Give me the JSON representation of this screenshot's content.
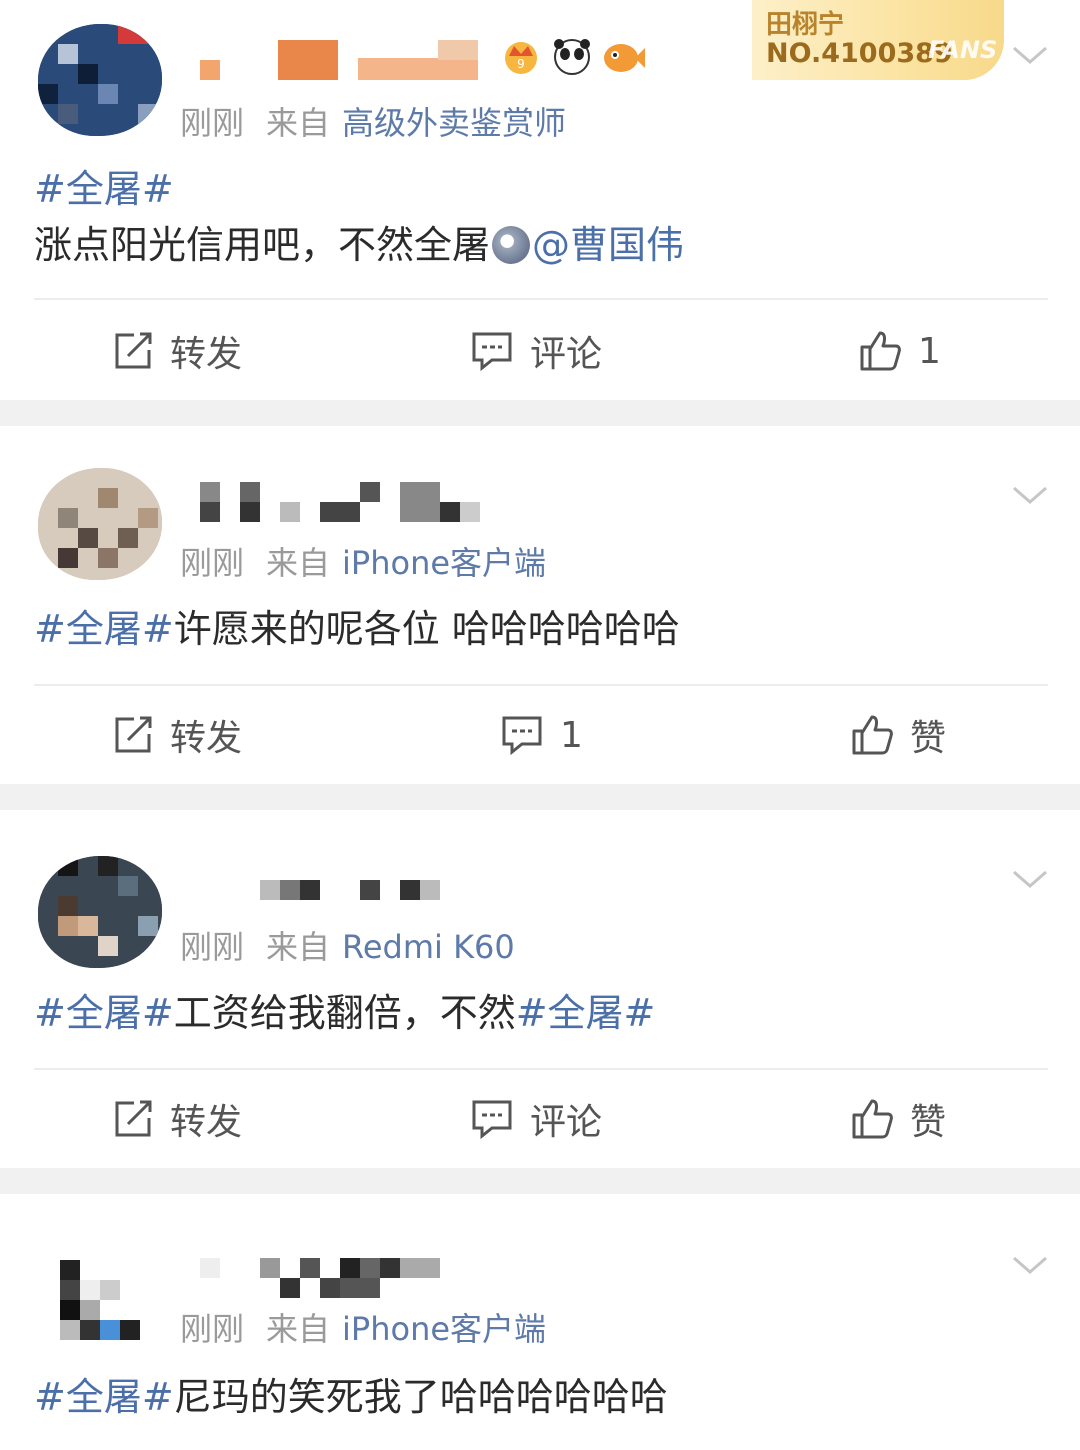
{
  "posts": [
    {
      "meta_time": "刚刚",
      "meta_from": "来自",
      "meta_source": "高级外卖鉴赏师",
      "content_tag": "#全屠#",
      "content_text": "涨点阳光信用吧，不然全屠",
      "content_mention": "@曹国伟",
      "action_repost": "转发",
      "action_comment": "评论",
      "action_like": "1"
    },
    {
      "meta_time": "刚刚",
      "meta_from": "来自",
      "meta_source": "iPhone客户端",
      "content_tag": "#全屠#",
      "content_text": "许愿来的呢各位 哈哈哈哈哈哈",
      "action_repost": "转发",
      "action_comment": "1",
      "action_like": "赞"
    },
    {
      "meta_time": "刚刚",
      "meta_from": "来自",
      "meta_source": "Redmi K60",
      "content_tag": "#全屠#",
      "content_text": "工资给我翻倍，不然",
      "content_tag2": "#全屠#",
      "action_repost": "转发",
      "action_comment": "评论",
      "action_like": "赞"
    },
    {
      "meta_time": "刚刚",
      "meta_from": "来自",
      "meta_source": "iPhone客户端",
      "content_tag": "#全屠#",
      "content_text": "尼玛的笑死我了哈哈哈哈哈哈"
    }
  ],
  "fans_badge": {
    "name": "田栩宁",
    "number": "NO.4100389",
    "label": "FANS"
  },
  "icons": [
    "chevron-down-icon",
    "repost-icon",
    "comment-icon",
    "like-icon",
    "crown-icon",
    "panda-icon",
    "fish-icon"
  ],
  "colors": {
    "link": "#4b6fa8",
    "meta": "#9a9a9a",
    "separator": "#f1f1f1"
  }
}
